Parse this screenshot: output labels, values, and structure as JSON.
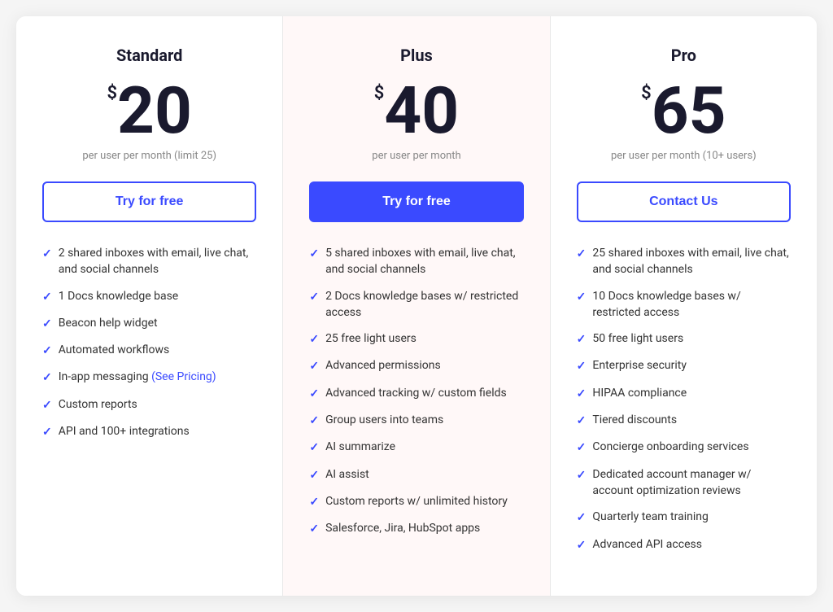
{
  "plans": [
    {
      "id": "standard",
      "name": "Standard",
      "currency": "$",
      "price": "20",
      "period": "per user per month (limit 25)",
      "cta_label": "Try for free",
      "cta_style": "outline",
      "highlighted": false,
      "features": [
        "2 shared inboxes with email, live chat, and social channels",
        "1 Docs knowledge base",
        "Beacon help widget",
        "Automated workflows",
        "In-app messaging (See Pricing)",
        "Custom reports",
        "API and 100+ integrations"
      ],
      "feature_links": {
        "4": {
          "text": "(See Pricing)",
          "url": "#"
        }
      }
    },
    {
      "id": "plus",
      "name": "Plus",
      "currency": "$",
      "price": "40",
      "period": "per user per month",
      "cta_label": "Try for free",
      "cta_style": "filled",
      "highlighted": true,
      "features": [
        "5 shared inboxes with email, live chat, and social channels",
        "2 Docs knowledge bases w/ restricted access",
        "25 free light users",
        "Advanced permissions",
        "Advanced tracking w/ custom fields",
        "Group users into teams",
        "AI summarize",
        "AI assist",
        "Custom reports w/ unlimited history",
        "Salesforce, Jira, HubSpot apps"
      ]
    },
    {
      "id": "pro",
      "name": "Pro",
      "currency": "$",
      "price": "65",
      "period": "per user per month (10+ users)",
      "cta_label": "Contact Us",
      "cta_style": "outline",
      "highlighted": false,
      "features": [
        "25 shared inboxes with email, live chat, and social channels",
        "10 Docs knowledge bases w/ restricted access",
        "50 free light users",
        "Enterprise security",
        "HIPAA compliance",
        "Tiered discounts",
        "Concierge onboarding services",
        "Dedicated account manager w/ account optimization reviews",
        "Quarterly team training",
        "Advanced API access"
      ]
    }
  ],
  "check_symbol": "✓"
}
